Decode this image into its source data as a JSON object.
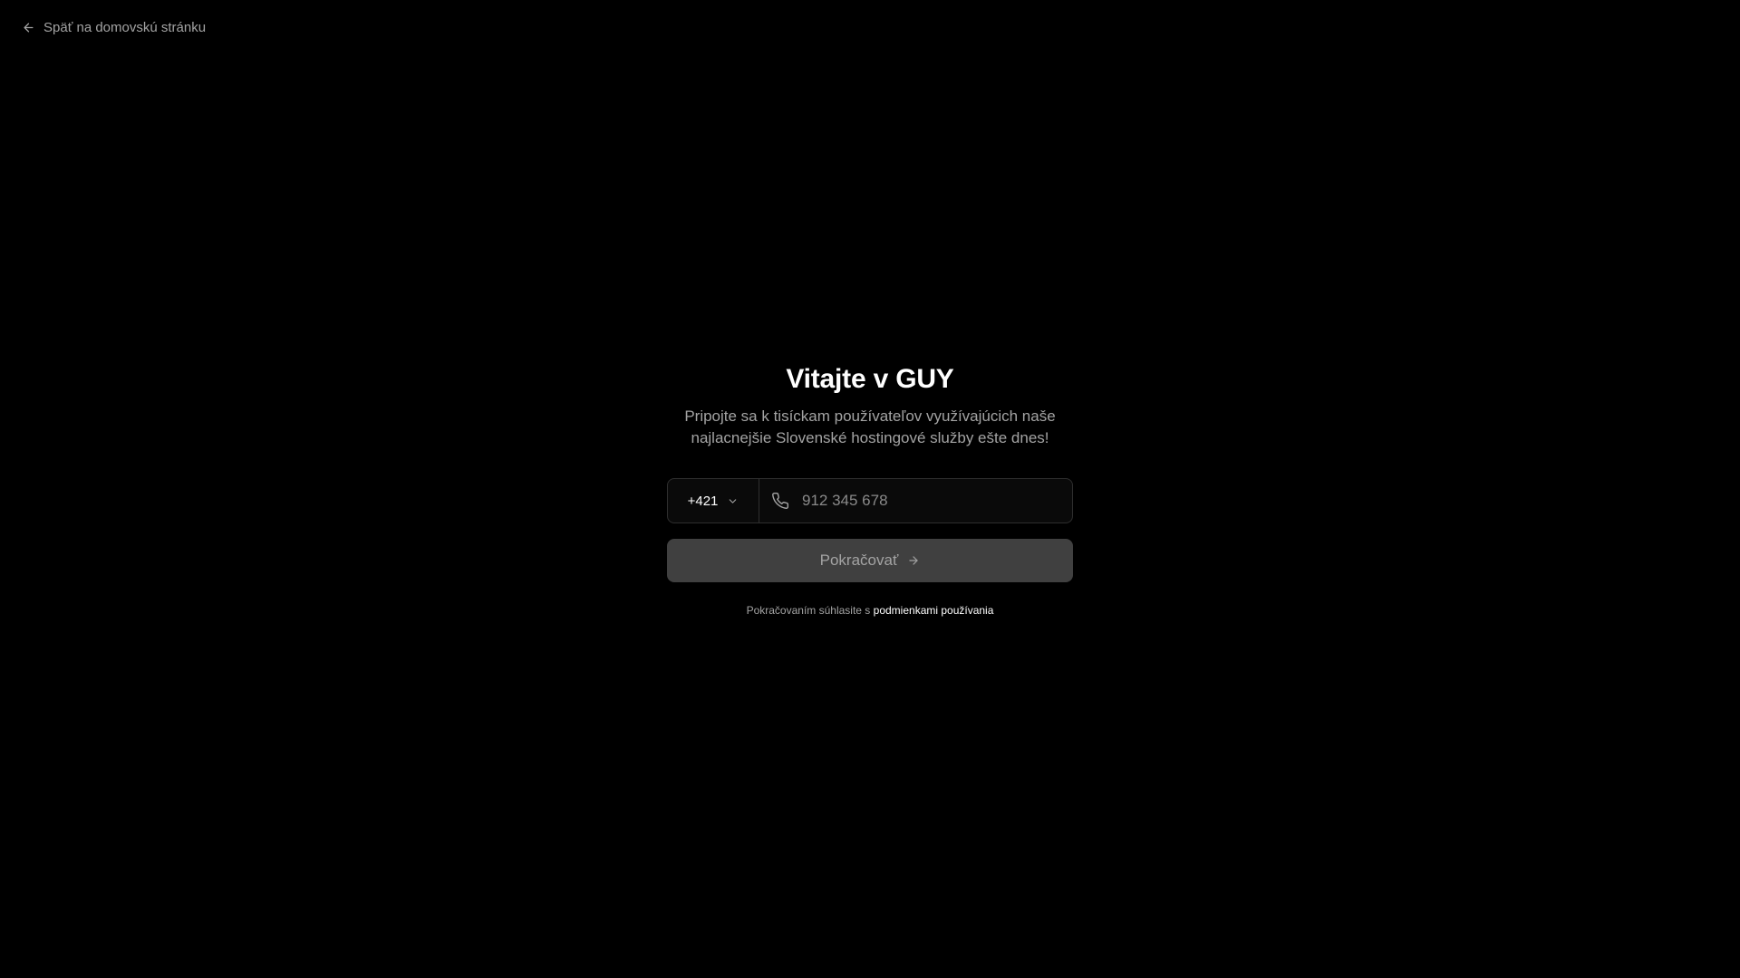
{
  "nav": {
    "back_label": "Späť na domovskú stránku",
    "back_icon": "arrow-left-icon"
  },
  "hero": {
    "title": "Vitajte v GUY",
    "subtitle": "Pripojte sa k tisíckam používateľov využívajúcich naše najlacnejšie Slovenské hostingové služby ešte dnes!"
  },
  "form": {
    "country_code": "+421",
    "country_icon": "chevron-down-icon",
    "phone_icon": "phone-icon",
    "phone_placeholder": "912 345 678",
    "phone_value": "",
    "continue_label": "Pokračovať",
    "continue_icon": "arrow-right-icon"
  },
  "terms": {
    "prefix": "Pokračovaním súhlasite s",
    "link_label": "podmienkami používania"
  },
  "colors": {
    "background": "#000000",
    "text_primary": "#ffffff",
    "text_muted": "#a3a3a3",
    "button_bg": "#404040",
    "border": "#2e2e2e"
  }
}
